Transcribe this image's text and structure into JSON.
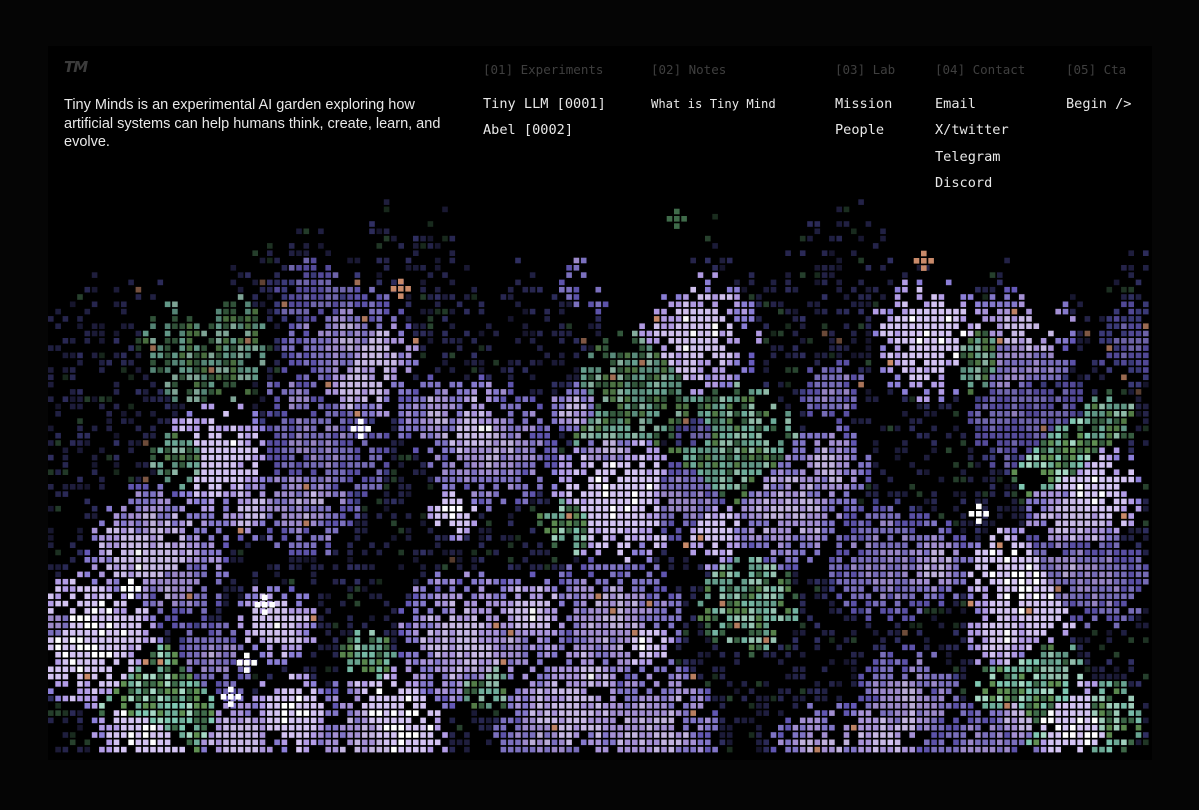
{
  "brand": {
    "logo": "TM",
    "tagline": "Tiny Minds is an experimental AI garden exploring how artificial systems can help humans think, create, learn, and evolve."
  },
  "nav": {
    "experiments": {
      "heading": "[01] Experiments",
      "items": [
        "Tiny LLM [0001]",
        "Abel [0002]"
      ]
    },
    "notes": {
      "heading": "[02] Notes",
      "items": [
        "What is Tiny Mind"
      ]
    },
    "lab": {
      "heading": "[03] Lab",
      "items": [
        "Mission",
        "People"
      ]
    },
    "contact": {
      "heading": "[04] Contact",
      "items": [
        "Email",
        "X/twitter",
        "Telegram",
        "Discord"
      ]
    },
    "cta": {
      "heading": "[05] Cta",
      "items": [
        "Begin />"
      ]
    }
  },
  "colors": {
    "page_bg": "#050505",
    "frame_bg": "#000000",
    "text": "#e8e8e8",
    "muted": "#3f3f3f",
    "palette": [
      "#3c3a78",
      "#4b4a9a",
      "#6a5ec2",
      "#8c7fd8",
      "#b29ce6",
      "#d3c3f2",
      "#6fae9a",
      "#7fc7b2",
      "#a6d8c4",
      "#3f6b4a",
      "#5f8f52",
      "#c98a6a",
      "#ffffff"
    ]
  }
}
